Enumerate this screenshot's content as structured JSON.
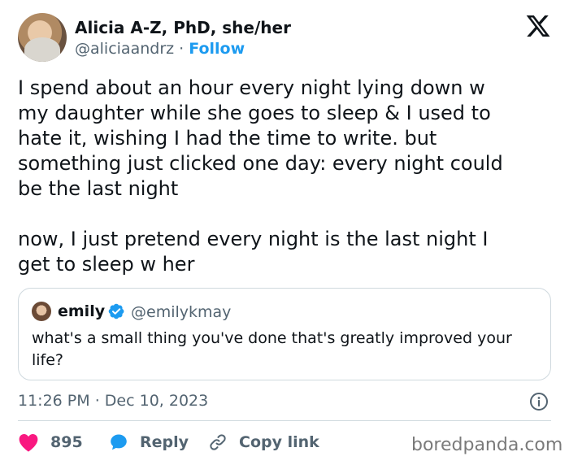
{
  "author": {
    "name": "Alicia A-Z, PhD, she/her",
    "handle": "@aliciaandrz",
    "separator": "·",
    "follow_label": "Follow"
  },
  "logo": "x-logo-icon",
  "tweet": {
    "text": "I spend about an hour every night lying down w\nmy daughter while she goes to sleep & I used to\nhate it, wishing I had the time to write. but\nsomething just clicked one day: every night could\nbe the last night\n\nnow, I just pretend every night is the last night I\nget to sleep w her"
  },
  "quote": {
    "name": "emily",
    "handle": "@emilykmay",
    "verified": true,
    "text": "what's a small thing you've done that's greatly improved your life?"
  },
  "meta": {
    "time": "11:26 PM",
    "separator": "·",
    "date": "Dec 10, 2023"
  },
  "actions": {
    "likes": "895",
    "reply_label": "Reply",
    "copy_link_label": "Copy link"
  },
  "watermark": "boredpanda.com",
  "colors": {
    "text": "#0f1419",
    "secondary": "#536471",
    "accent": "#1d9bf0",
    "like": "#f91880",
    "border": "#cfd9de"
  }
}
